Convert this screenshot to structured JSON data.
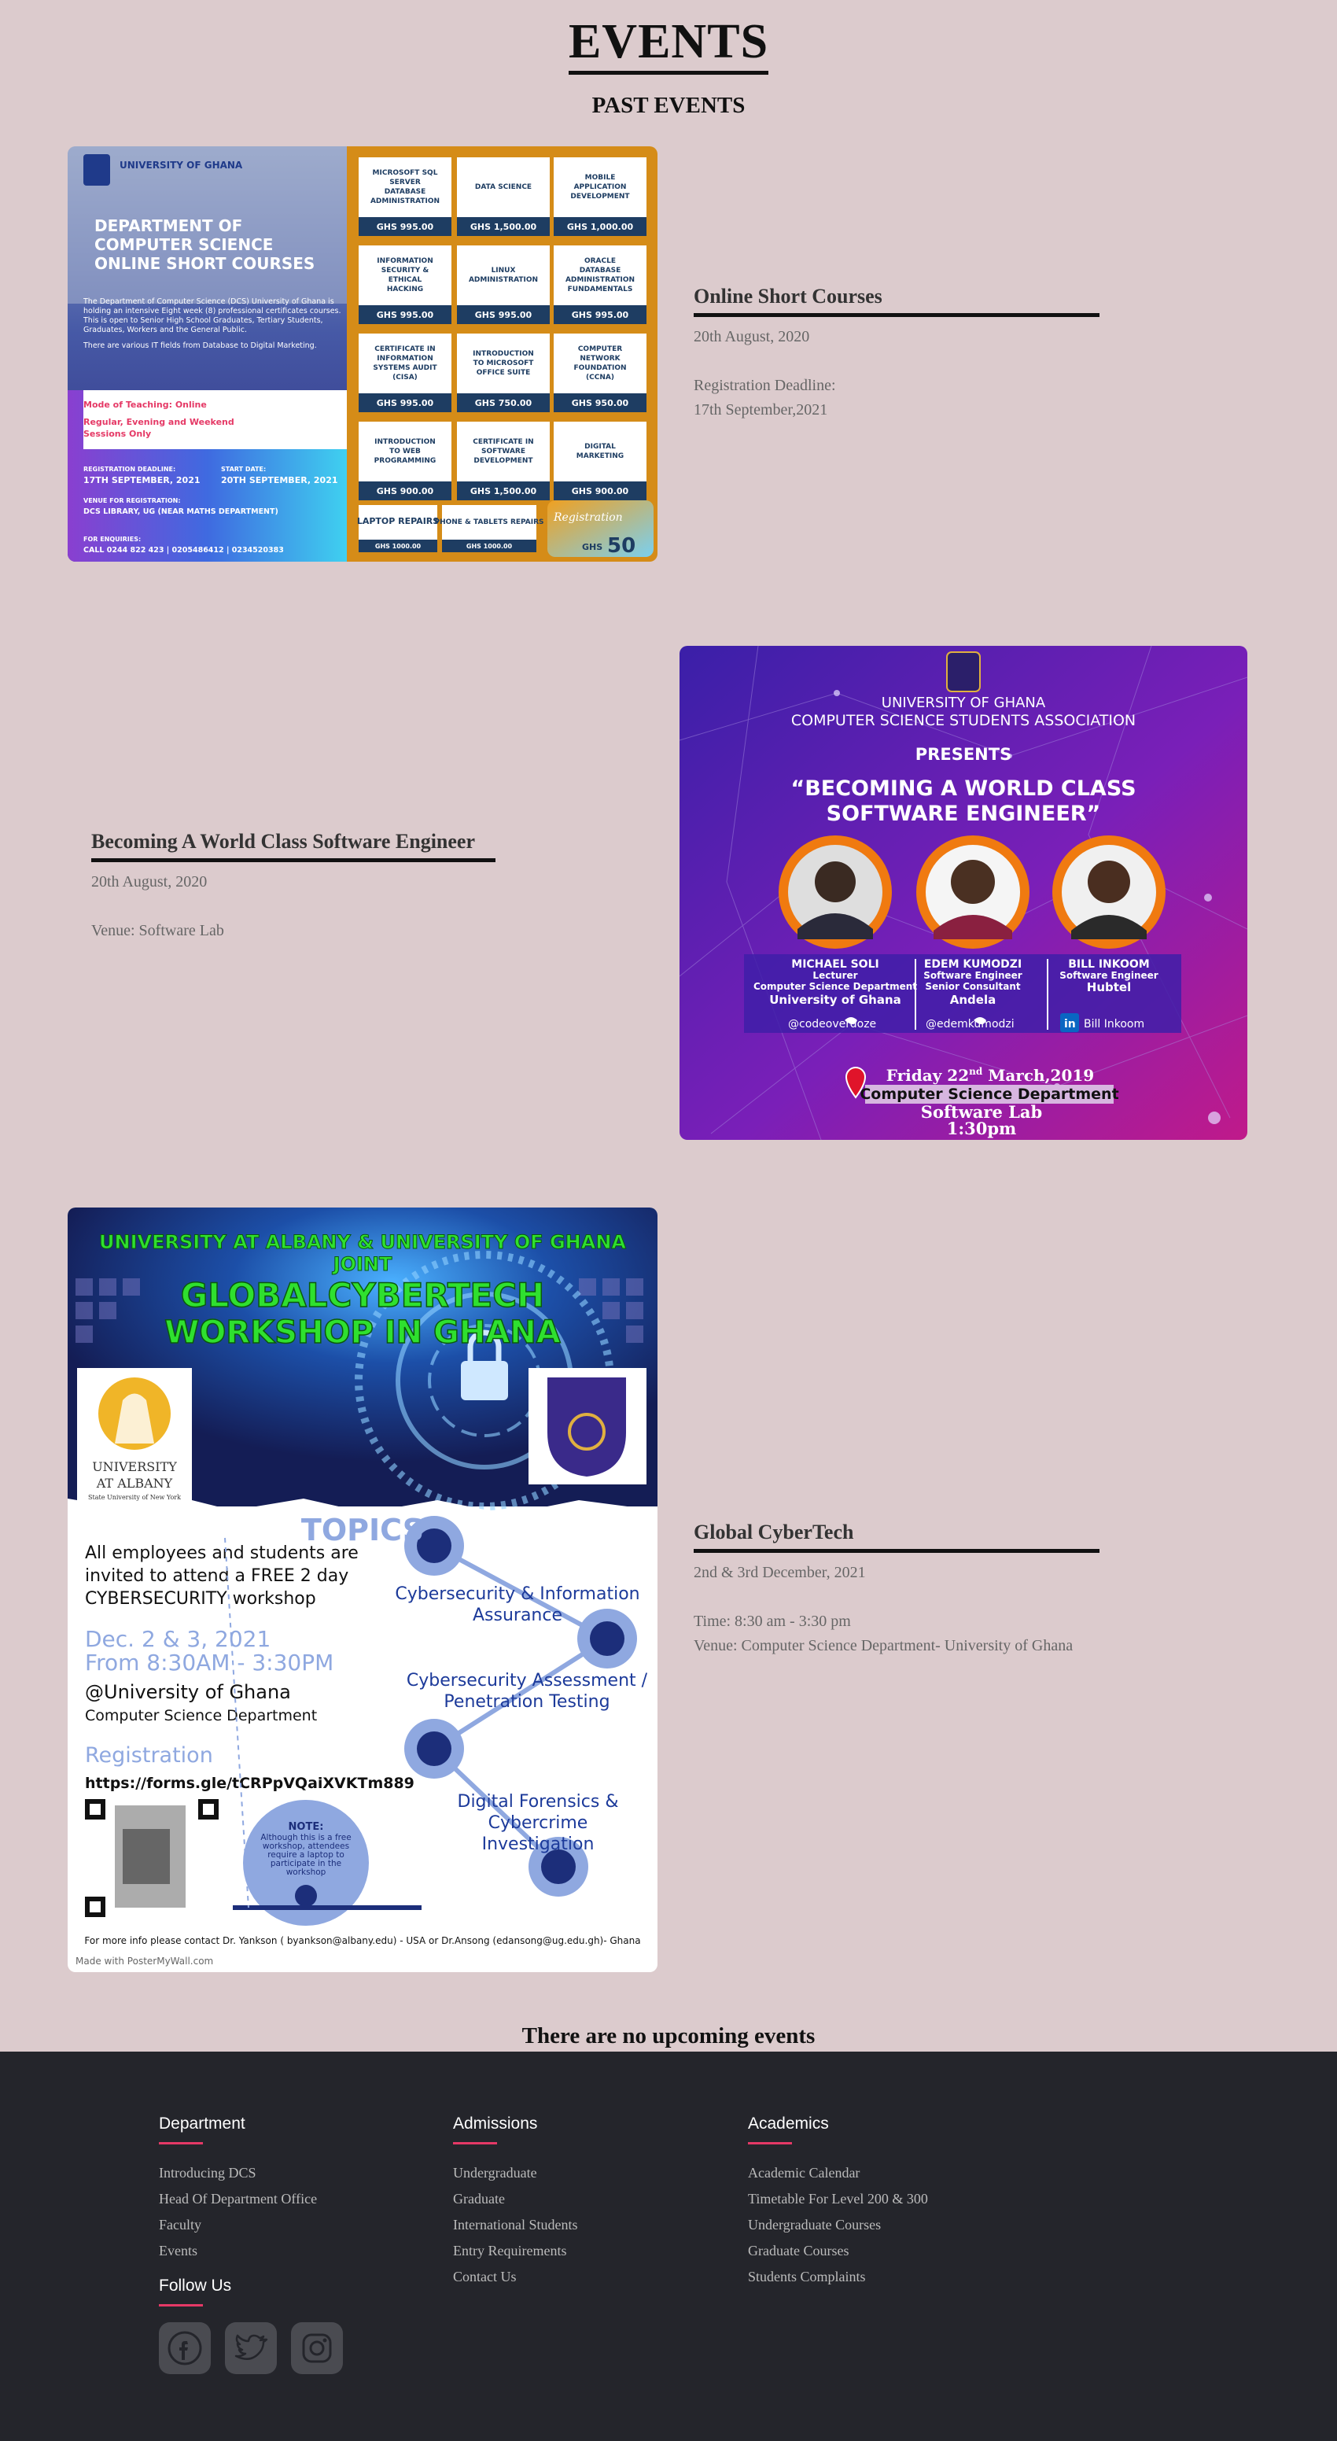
{
  "page": {
    "title": "EVENTS",
    "subtitle": "PAST EVENTS",
    "no_upcoming": "There are no upcoming events"
  },
  "events": [
    {
      "title": "Online Short Courses",
      "date": "20th August, 2020",
      "line1": "Registration Deadline:",
      "line2": "17th September,2021",
      "poster": {
        "uni": "UNIVERSITY OF GHANA",
        "heading": [
          "DEPARTMENT OF",
          "COMPUTER SCIENCE",
          "ONLINE SHORT COURSES"
        ],
        "body1": "The Department of Computer Science (DCS) University of Ghana is holding an intensive Eight week (8) professional certificates courses. This is open to Senior High School Graduates, Tertiary Students, Graduates, Workers and the General Public.",
        "body2": "There are various IT fields from Database to Digital Marketing.",
        "mode1": "Mode of Teaching: Online",
        "mode2": "Regular, Evening and Weekend",
        "mode3": "Sessions Only",
        "deadline_label": "REGISTRATION DEADLINE:",
        "deadline": "17TH SEPTEMBER, 2021",
        "start_label": "START DATE:",
        "start": "20TH SEPTEMBER, 2021",
        "venue_label": "VENUE FOR REGISTRATION:",
        "venue": "DCS LIBRARY, UG (NEAR MATHS DEPARTMENT)",
        "enq_label": "FOR ENQUIRIES:",
        "enq": "CALL 0244 822 423  | 0205486412 | 0234520383",
        "courses": [
          {
            "name": "MICROSOFT SQL SERVER DATABASE ADMINISTRATION",
            "price": "GHS 995.00"
          },
          {
            "name": "DATA SCIENCE",
            "price": "GHS 1,500.00"
          },
          {
            "name": "MOBILE APPLICATION DEVELOPMENT",
            "price": "GHS 1,000.00"
          },
          {
            "name": "INFORMATION SECURITY & ETHICAL HACKING",
            "price": "GHS 995.00"
          },
          {
            "name": "LINUX ADMINISTRATION",
            "price": "GHS 995.00"
          },
          {
            "name": "ORACLE DATABASE ADMINISTRATION FUNDAMENTALS",
            "price": "GHS 995.00"
          },
          {
            "name": "CERTIFICATE IN INFORMATION SYSTEMS AUDIT (CISA)",
            "price": "GHS 995.00"
          },
          {
            "name": "INTRODUCTION TO MICROSOFT OFFICE SUITE",
            "price": "GHS 750.00"
          },
          {
            "name": "COMPUTER NETWORK FOUNDATION (CCNA)",
            "price": "GHS 950.00"
          },
          {
            "name": "INTRODUCTION TO WEB PROGRAMMING",
            "price": "GHS 900.00"
          },
          {
            "name": "CERTIFICATE IN SOFTWARE DEVELOPMENT",
            "price": "GHS 1,500.00"
          },
          {
            "name": "DIGITAL MARKETING",
            "price": "GHS 900.00"
          }
        ],
        "laptop": {
          "name": "LAPTOP REPAIRS",
          "price": "GHS 1000.00"
        },
        "phone": {
          "name": "PHONE & TABLETS REPAIRS",
          "price": "GHS 1000.00"
        },
        "reg_script": "Registration",
        "reg_price": "50",
        "reg_currency": "GHS"
      }
    },
    {
      "title": "Becoming A World Class Software Engineer",
      "date": "20th August, 2020",
      "line1": "Venue: Software Lab",
      "poster": {
        "org1": "UNIVERSITY OF GHANA",
        "org2": "COMPUTER SCIENCE STUDENTS ASSOCIATION",
        "presents": "PRESENTS",
        "heading1": "“BECOMING A WORLD CLASS",
        "heading2": "SOFTWARE ENGINEER”",
        "speakers": [
          {
            "name": "MICHAEL SOLI",
            "l1": "Lecturer",
            "l2": "Computer Science Department",
            "l3": "University of Ghana",
            "handle": "@codeoverdoze"
          },
          {
            "name": "EDEM KUMODZI",
            "l1": "Software Engineer",
            "l2": "Senior Consultant",
            "l3": "Andela",
            "handle": "@edemkumodzi"
          },
          {
            "name": "BILL INKOOM",
            "l1": "Software Engineer",
            "l2": "Hubtel",
            "l3": "",
            "handle": "Bill Inkoom"
          }
        ],
        "day": "Friday 22",
        "sup": "nd",
        "month": " March,2019",
        "venue1": "Computer Science Department",
        "venue2": "Software Lab",
        "time": "1:30pm"
      }
    },
    {
      "title": "Global CyberTech",
      "date": "2nd & 3rd December, 2021",
      "line1": "Time: 8:30 am - 3:30 pm",
      "line2": "Venue: Computer Science Department- University of Ghana",
      "poster": {
        "top1": "UNIVERSITY AT ALBANY &  UNIVERSITY OF GHANA",
        "top2": "JOINT",
        "title1": "GLOBALCYBERTECH",
        "title2": "WORKSHOP IN GHANA",
        "albany1": "UNIVERSITY",
        "albany2": "AT ALBANY",
        "albany3": "State University of New York",
        "topics": "TOPICS",
        "intro": "All employees and students are invited to attend a FREE 2 day CYBERSECURITY workshop",
        "dates1": "Dec. 2 & 3, 2021",
        "dates2": "From 8:30AM - 3:30PM",
        "at": "@University of Ghana",
        "dept": "Computer Science Department",
        "reg": "Registration",
        "link": "https://forms.gle/tCRPpVQaiXVKTm889",
        "t1": "Cybersecurity & Information Assurance",
        "t2": "Cybersecurity Assessment / Penetration Testing",
        "t3": "Digital Forensics & Cybercrime Investigation",
        "note_title": "NOTE:",
        "note": "Although this is a free workshop, attendees require a laptop to participate in the workshop",
        "contact": "For more info please contact Dr. Yankson ( byankson@albany.edu) - USA   or Dr.Ansong (edansong@ug.edu.gh)- Ghana",
        "made": "Made with PosterMyWall.com"
      }
    }
  ],
  "footer": {
    "department": {
      "heading": "Department",
      "links": [
        "Introducing DCS",
        "Head Of Department Office",
        "Faculty",
        "Events"
      ]
    },
    "follow": {
      "heading": "Follow Us",
      "icons": [
        "facebook-icon",
        "twitter-icon",
        "instagram-icon"
      ]
    },
    "admissions": {
      "heading": "Admissions",
      "links": [
        "Undergraduate",
        "Graduate",
        "International Students",
        "Entry Requirements",
        "Contact Us"
      ]
    },
    "academics": {
      "heading": "Academics",
      "links": [
        "Academic Calendar",
        "Timetable For Level 200 & 300",
        "Undergraduate Courses",
        "Graduate Courses",
        "Students Complaints"
      ]
    }
  }
}
